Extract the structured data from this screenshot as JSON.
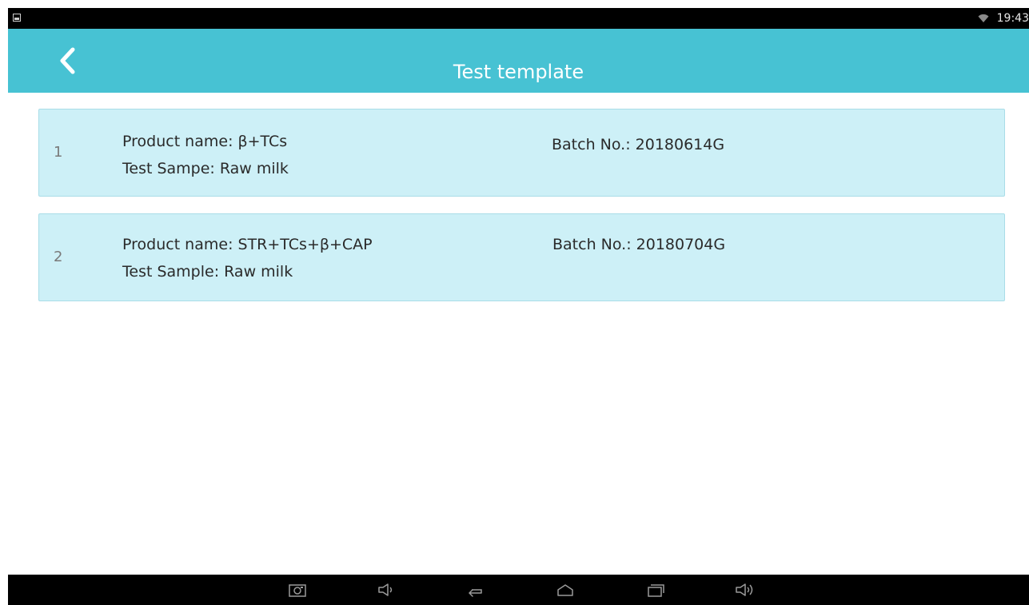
{
  "status_bar": {
    "time": "19:43",
    "icons": [
      "image-notification-icon",
      "wifi-icon"
    ]
  },
  "app_bar": {
    "title": "Test template",
    "back_icon": "chevron-left-icon",
    "color": "#47c2d3"
  },
  "templates": [
    {
      "index": "1",
      "product": "Product name: β+TCs",
      "sample": "Test Sampe: Raw milk",
      "batch": "Batch No.: 20180614G"
    },
    {
      "index": "2",
      "product": "Product name: STR+TCs+β+CAP",
      "sample": "Test Sample: Raw milk",
      "batch": "Batch No.: 20180704G"
    }
  ],
  "nav_bar": {
    "icons": [
      "screenshot-icon",
      "volume-down-icon",
      "back-icon",
      "home-icon",
      "recent-apps-icon",
      "volume-up-icon"
    ]
  },
  "colors": {
    "card_background": "#cdf0f7",
    "card_border": "#a9dde8"
  }
}
